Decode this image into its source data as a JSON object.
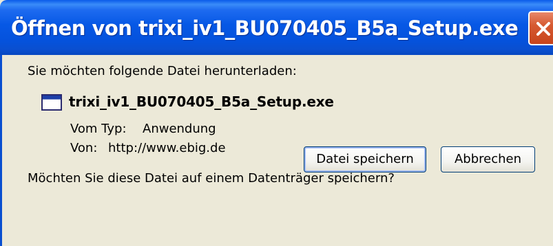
{
  "window": {
    "title": "Öffnen von trixi_iv1_BU070405_B5a_Setup.exe",
    "close_icon": "close-icon"
  },
  "dialog": {
    "prompt": "Sie möchten folgende Datei herunterladen:",
    "file_icon": "application-window-icon",
    "file_name": "trixi_iv1_BU070405_B5a_Setup.exe",
    "type_label": "Vom Typ:",
    "type_value": "Anwendung",
    "from_label": "Von:",
    "from_value": "http://www.ebig.de",
    "question": "Möchten Sie diese Datei auf einem Datenträger speichern?"
  },
  "buttons": {
    "save_label": "Datei speichern",
    "cancel_label": "Abbrechen"
  },
  "colors": {
    "titlebar": "#0658E5",
    "dialog_background": "#ECE9D8",
    "close_button": "#D65A32",
    "button_border": "#003C74"
  }
}
